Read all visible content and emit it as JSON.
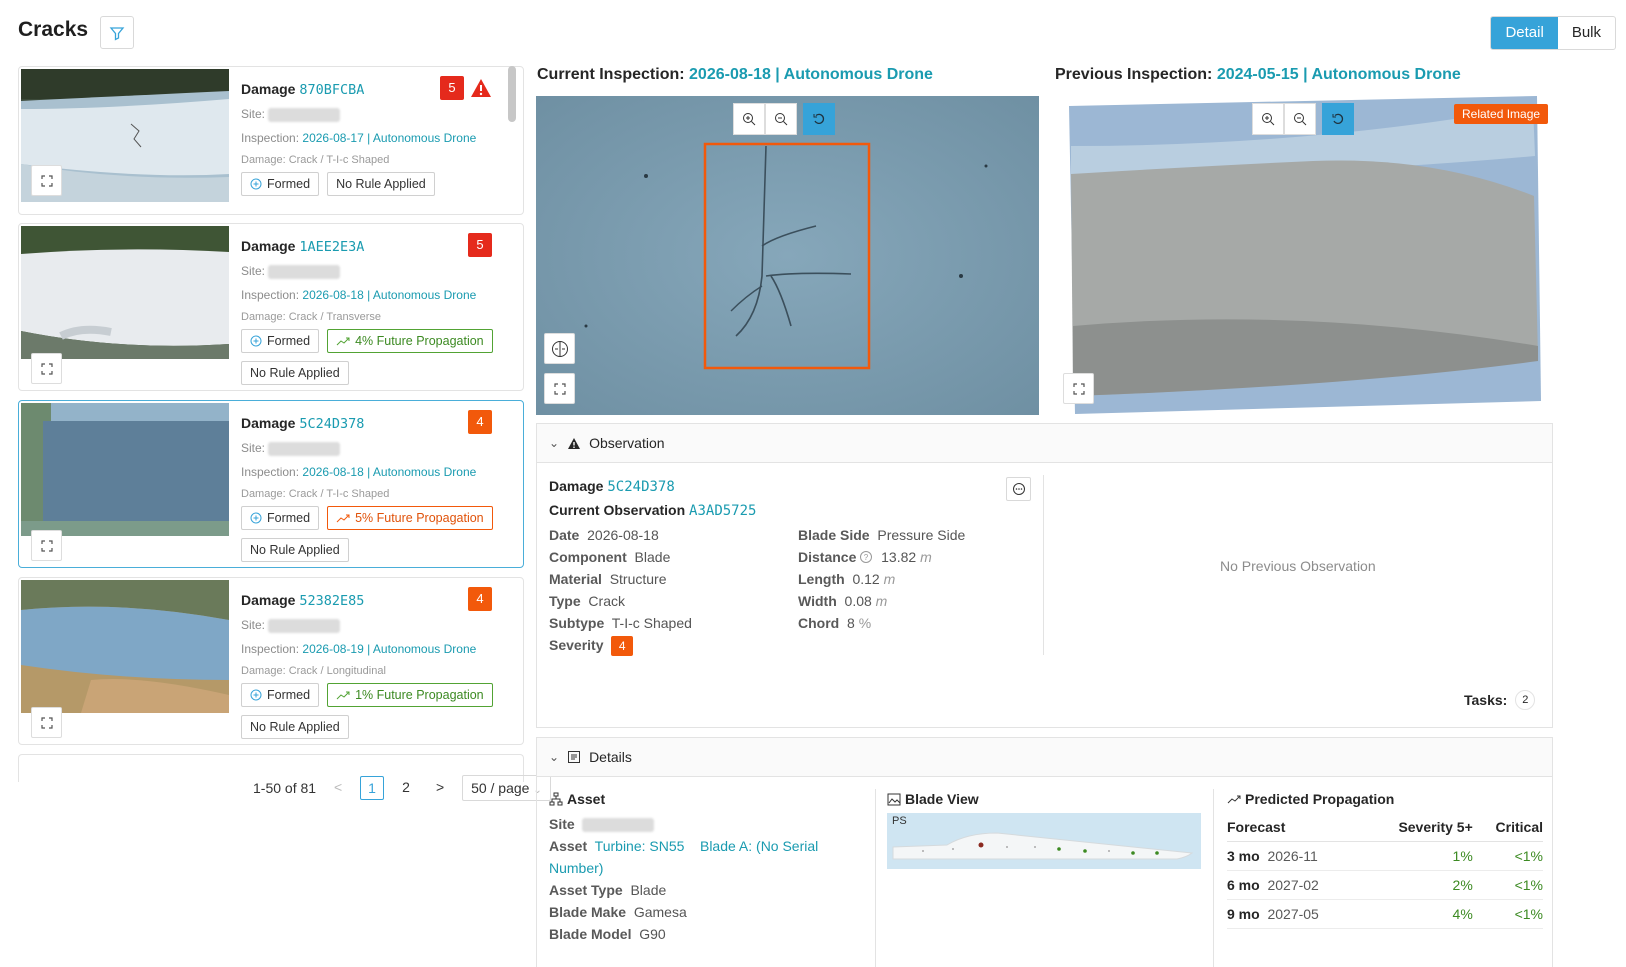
{
  "header": {
    "title": "Cracks",
    "view_toggle": [
      "Detail",
      "Bulk"
    ]
  },
  "cards": [
    {
      "damage_label": "Damage",
      "damage_id": "870BFCBA",
      "site_label": "Site:",
      "inspection_label": "Inspection:",
      "inspection_value": "2026-08-17 | Autonomous Drone",
      "damage_type": "Damage: Crack / T-I-c Shaped",
      "severity": "5",
      "tags": [
        "Formed",
        "No Rule Applied"
      ]
    },
    {
      "damage_label": "Damage",
      "damage_id": "1AEE2E3A",
      "site_label": "Site:",
      "inspection_label": "Inspection:",
      "inspection_value": "2026-08-18 | Autonomous Drone",
      "damage_type": "Damage: Crack / Transverse",
      "severity": "5",
      "tags": [
        "Formed",
        "4% Future Propagation",
        "No Rule Applied"
      ]
    },
    {
      "damage_label": "Damage",
      "damage_id": "5C24D378",
      "site_label": "Site:",
      "inspection_label": "Inspection:",
      "inspection_value": "2026-08-18 | Autonomous Drone",
      "damage_type": "Damage: Crack / T-I-c Shaped",
      "severity": "4",
      "tags": [
        "Formed",
        "5% Future Propagation",
        "No Rule Applied"
      ]
    },
    {
      "damage_label": "Damage",
      "damage_id": "52382E85",
      "site_label": "Site:",
      "inspection_label": "Inspection:",
      "inspection_value": "2026-08-19 | Autonomous Drone",
      "damage_type": "Damage: Crack / Longitudinal",
      "severity": "4",
      "tags": [
        "Formed",
        "1% Future Propagation",
        "No Rule Applied"
      ]
    }
  ],
  "pagination": {
    "range": "1-50 of 81",
    "prev": "<",
    "pages": [
      "1",
      "2"
    ],
    "next": ">",
    "page_size": "50 / page"
  },
  "current_inspection": {
    "label": "Current Inspection:",
    "value": "2026-08-18 | Autonomous Drone"
  },
  "previous_inspection": {
    "label": "Previous Inspection:",
    "value": "2024-05-15 | Autonomous Drone",
    "badge": "Related Image"
  },
  "observation": {
    "header": "Observation",
    "damage_label": "Damage",
    "damage_id": "5C24D378",
    "current_label": "Current Observation",
    "current_id": "A3AD5725",
    "left": [
      {
        "k": "Date",
        "v": "2026-08-18"
      },
      {
        "k": "Component",
        "v": "Blade"
      },
      {
        "k": "Material",
        "v": "Structure"
      },
      {
        "k": "Type",
        "v": "Crack"
      },
      {
        "k": "Subtype",
        "v": "T-I-c Shaped"
      }
    ],
    "severity_label": "Severity",
    "severity_value": "4",
    "right": [
      {
        "k": "Blade Side",
        "v": "Pressure Side",
        "u": ""
      },
      {
        "k": "Distance",
        "v": "13.82",
        "u": "m"
      },
      {
        "k": "Length",
        "v": "0.12",
        "u": "m"
      },
      {
        "k": "Width",
        "v": "0.08",
        "u": "m"
      },
      {
        "k": "Chord",
        "v": "8",
        "u": "%"
      }
    ],
    "no_previous": "No Previous Observation",
    "tasks_label": "Tasks:",
    "tasks_count": "2"
  },
  "details": {
    "header": "Details",
    "asset": {
      "title": "Asset",
      "site_label": "Site",
      "asset_label": "Asset",
      "asset_value_1": "Turbine: SN55",
      "asset_value_2": "Blade A: (No Serial",
      "asset_value_3": "Number)",
      "asset_type_label": "Asset Type",
      "asset_type_value": "Blade",
      "blade_make_label": "Blade Make",
      "blade_make_value": "Gamesa",
      "blade_model_label": "Blade Model",
      "blade_model_value": "G90"
    },
    "blade_view": {
      "title": "Blade View",
      "side": "PS"
    },
    "propagation": {
      "title": "Predicted Propagation",
      "columns": [
        "Forecast",
        "Severity 5+",
        "Critical"
      ],
      "rows": [
        {
          "h": "3 mo",
          "d": "2026-11",
          "s": "1%",
          "c": "<1%"
        },
        {
          "h": "6 mo",
          "d": "2027-02",
          "s": "2%",
          "c": "<1%"
        },
        {
          "h": "9 mo",
          "d": "2027-05",
          "s": "4%",
          "c": "<1%"
        }
      ]
    }
  }
}
